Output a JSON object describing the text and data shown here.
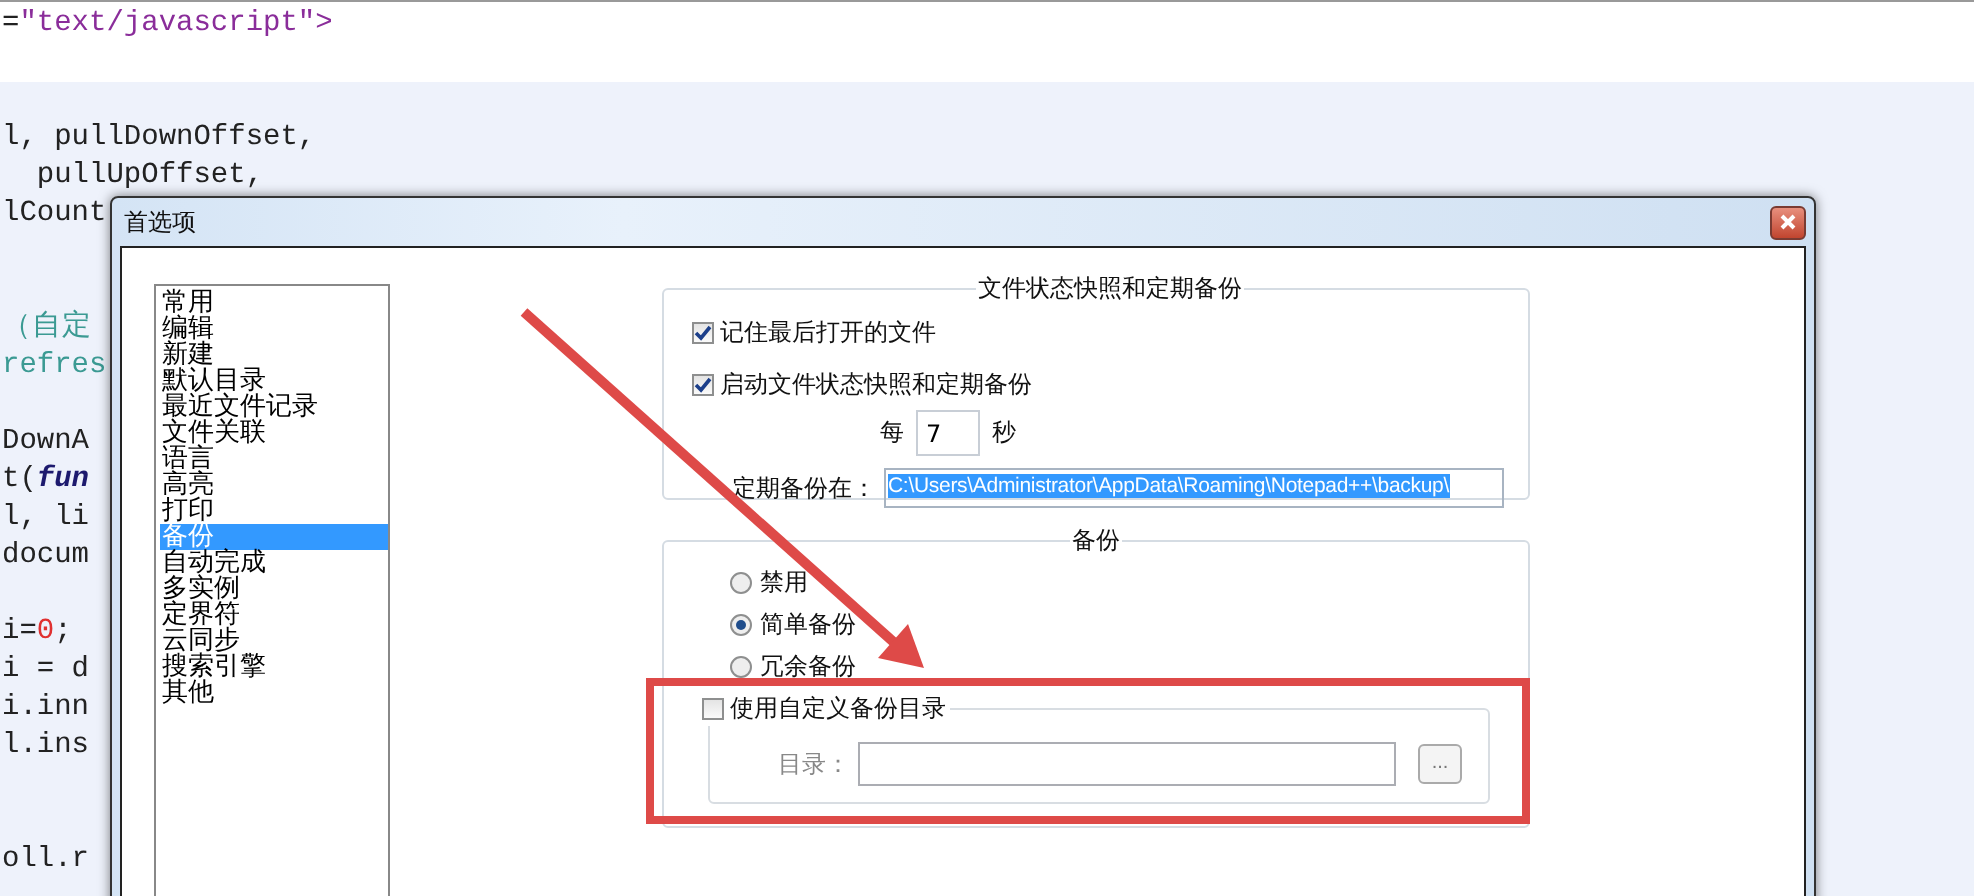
{
  "editor": {
    "lines": [
      {
        "kind": "code",
        "segments": [
          {
            "text": "=",
            "kind": "plain"
          },
          {
            "text": "\"text/javascript\">",
            "kind": "string"
          }
        ]
      },
      {
        "kind": "blank"
      },
      {
        "kind": "blank"
      },
      {
        "kind": "code",
        "segments": [
          {
            "text": "l, pullDownOffset,",
            "kind": "plain"
          }
        ]
      },
      {
        "kind": "code",
        "segments": [
          {
            "text": "  pullUpOffset,",
            "kind": "plain"
          }
        ]
      },
      {
        "kind": "code",
        "segments": [
          {
            "text": "lCount",
            "kind": "plain"
          }
        ]
      },
      {
        "kind": "blank"
      },
      {
        "kind": "blank"
      },
      {
        "kind": "code",
        "segments": [
          {
            "text": "（自定",
            "kind": "comment"
          }
        ]
      },
      {
        "kind": "code",
        "segments": [
          {
            "text": "refres",
            "kind": "comment"
          }
        ]
      },
      {
        "kind": "blank"
      },
      {
        "kind": "code",
        "segments": [
          {
            "text": "DownA",
            "kind": "plain"
          }
        ]
      },
      {
        "kind": "code",
        "segments": [
          {
            "text": "t(",
            "kind": "plain"
          },
          {
            "text": "fun",
            "kind": "keyword"
          }
        ]
      },
      {
        "kind": "code",
        "segments": [
          {
            "text": "l, li",
            "kind": "plain"
          }
        ]
      },
      {
        "kind": "code",
        "segments": [
          {
            "text": "docum",
            "kind": "plain"
          }
        ]
      },
      {
        "kind": "blank"
      },
      {
        "kind": "code",
        "segments": [
          {
            "text": "i=",
            "kind": "plain"
          },
          {
            "text": "0",
            "kind": "number"
          },
          {
            "text": ";",
            "kind": "plain"
          }
        ]
      },
      {
        "kind": "code",
        "segments": [
          {
            "text": "i = d",
            "kind": "plain"
          }
        ]
      },
      {
        "kind": "code",
        "segments": [
          {
            "text": "i.inn",
            "kind": "plain"
          }
        ]
      },
      {
        "kind": "code",
        "segments": [
          {
            "text": "l.ins",
            "kind": "plain"
          }
        ]
      },
      {
        "kind": "blank"
      },
      {
        "kind": "blank"
      },
      {
        "kind": "code",
        "segments": [
          {
            "text": "oll.r",
            "kind": "plain"
          }
        ]
      }
    ]
  },
  "dialog": {
    "title": "首选项",
    "categories": [
      {
        "label": "常用",
        "selected": false
      },
      {
        "label": "编辑",
        "selected": false
      },
      {
        "label": "新建",
        "selected": false
      },
      {
        "label": "默认目录",
        "selected": false
      },
      {
        "label": "最近文件记录",
        "selected": false
      },
      {
        "label": "文件关联",
        "selected": false
      },
      {
        "label": "语言",
        "selected": false
      },
      {
        "label": "高亮",
        "selected": false
      },
      {
        "label": "打印",
        "selected": false
      },
      {
        "label": "备份",
        "selected": true
      },
      {
        "label": "自动完成",
        "selected": false
      },
      {
        "label": "多实例",
        "selected": false
      },
      {
        "label": "定界符",
        "selected": false
      },
      {
        "label": "云同步",
        "selected": false
      },
      {
        "label": "搜索引擎",
        "selected": false
      },
      {
        "label": "其他",
        "selected": false
      }
    ],
    "snapshot_group": {
      "title": "文件状态快照和定期备份",
      "options": [
        {
          "label": "记住最后打开的文件",
          "checked": true
        },
        {
          "label": "启动文件状态快照和定期备份",
          "checked": true
        }
      ],
      "interval_prefix": "每",
      "interval_value": "7",
      "interval_suffix": "秒",
      "path_label": "定期备份在：",
      "path_value": "C:\\Users\\Administrator\\AppData\\Roaming\\Notepad++\\backup\\"
    },
    "backup_group": {
      "title": "备份",
      "modes": [
        {
          "label": "禁用",
          "selected": false
        },
        {
          "label": "简单备份",
          "selected": true
        },
        {
          "label": "冗余备份",
          "selected": false
        }
      ],
      "custom_dir": {
        "label": "使用自定义备份目录",
        "checked": false,
        "dir_label": "目录：",
        "browse": "...",
        "disabled": true
      }
    }
  }
}
